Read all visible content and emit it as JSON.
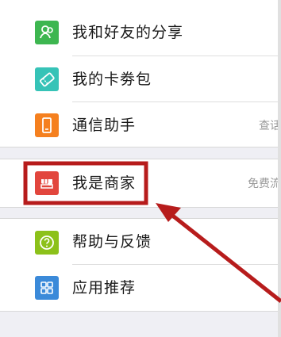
{
  "menu": {
    "groups": [
      {
        "items": [
          {
            "label": "我和好友的分享",
            "icon": "share-friends-icon",
            "color": "#3db650",
            "right": ""
          },
          {
            "label": "我的卡劵包",
            "icon": "coupon-icon",
            "color": "#36c3b7",
            "right": ""
          },
          {
            "label": "通信助手",
            "icon": "phone-assistant-icon",
            "color": "#f5801f",
            "right": "查话"
          }
        ]
      },
      {
        "items": [
          {
            "label": "我是商家",
            "icon": "merchant-shop-icon",
            "color": "#e2463d",
            "right": "免费流"
          }
        ]
      },
      {
        "items": [
          {
            "label": "帮助与反馈",
            "icon": "help-feedback-icon",
            "color": "#8cc11a",
            "right": ""
          },
          {
            "label": "应用推荐",
            "icon": "app-recommend-icon",
            "color": "#3b8ad9",
            "right": ""
          }
        ]
      }
    ]
  },
  "annotation": {
    "highlight_color": "#b71c1c",
    "arrow_color": "#b71c1c"
  }
}
